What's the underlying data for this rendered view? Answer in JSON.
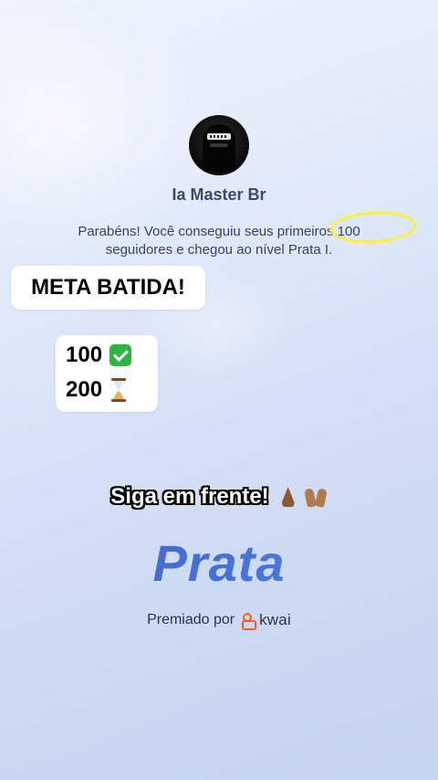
{
  "profile": {
    "name": "Ia Master Br",
    "avatar_icon": "masked-avatar"
  },
  "message": {
    "line1": "Parabéns! Você conseguiu seus primeiros 100",
    "line2": "seguidores e chegou ao nível Prata I."
  },
  "meta": {
    "label": "META BATIDA!"
  },
  "progress": {
    "items": [
      {
        "value": "100",
        "icon": "check-mark-icon",
        "status": "done"
      },
      {
        "value": "200",
        "icon": "hourglass-icon",
        "status": "pending"
      }
    ]
  },
  "caption": {
    "text": "Siga em frente!",
    "emoji_icons": [
      "praying-hands-icon",
      "raising-hands-icon"
    ]
  },
  "tier": {
    "name": "Prata",
    "color": "#3b63c9"
  },
  "footer": {
    "prefix": "Premiado por",
    "brand": "kwai",
    "brand_color": "#ff5a1f"
  },
  "colors": {
    "highlight_ring": "#f3ee5a",
    "check": "#2fb344"
  }
}
